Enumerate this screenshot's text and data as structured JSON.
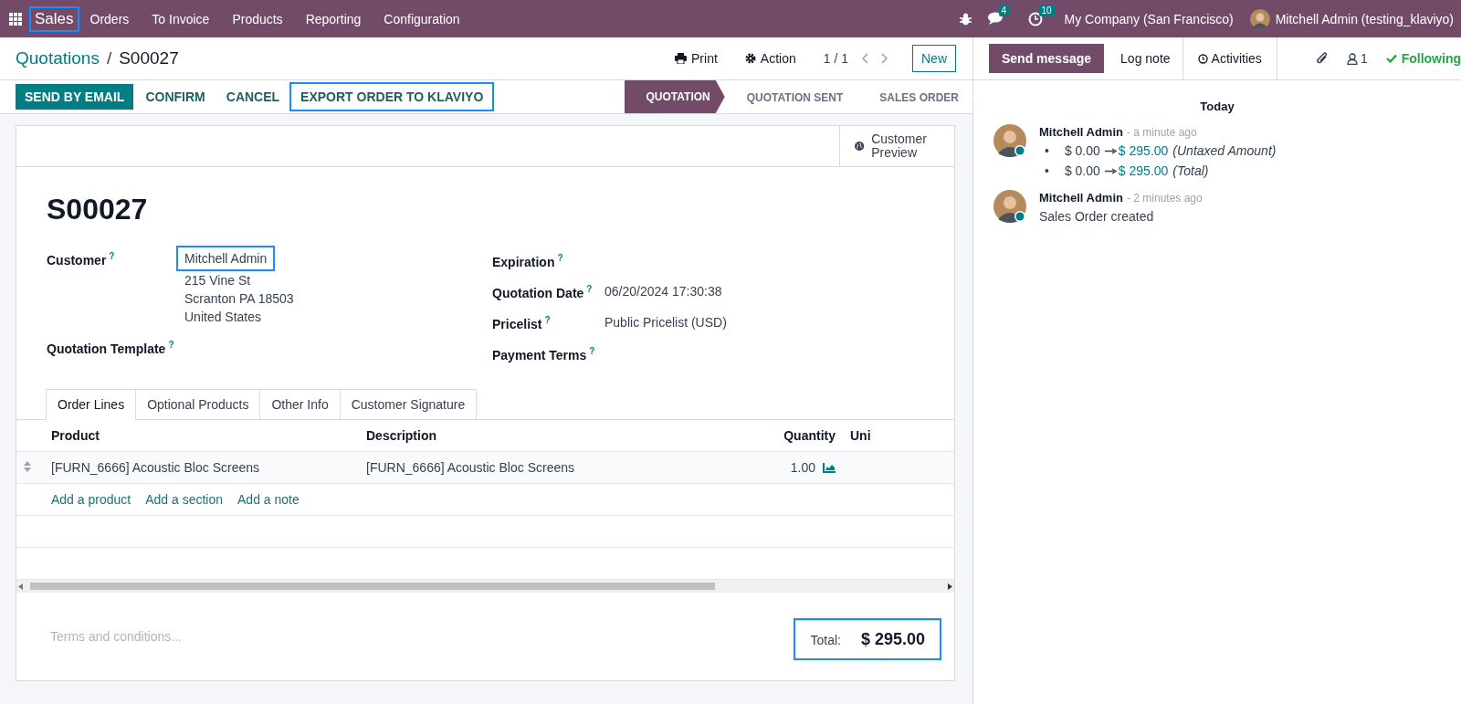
{
  "navbar": {
    "app": {
      "label": "Sales",
      "highlighted": true
    },
    "menu": [
      "Orders",
      "To Invoice",
      "Products",
      "Reporting",
      "Configuration"
    ],
    "messages_count": "4",
    "activities_count": "10",
    "company": "My Company (San Francisco)",
    "user": "Mitchell Admin (testing_klaviyo)"
  },
  "breadcrumb": {
    "parent": "Quotations",
    "separator": "/",
    "current": "S00027"
  },
  "control_panel": {
    "print": "Print",
    "action": "Action",
    "pager": "1 / 1",
    "new": "New"
  },
  "actions": [
    {
      "label": "SEND BY EMAIL",
      "kind": "primary",
      "highlighted": false
    },
    {
      "label": "CONFIRM",
      "kind": "secondary",
      "highlighted": false
    },
    {
      "label": "CANCEL",
      "kind": "secondary",
      "highlighted": false
    },
    {
      "label": "EXPORT ORDER TO KLAVIYO",
      "kind": "secondary",
      "highlighted": true
    }
  ],
  "status_steps": [
    {
      "label": "QUOTATION",
      "selected": true
    },
    {
      "label": "QUOTATION SENT",
      "selected": false
    },
    {
      "label": "SALES ORDER",
      "selected": false
    }
  ],
  "form": {
    "customer_preview": "Customer Preview",
    "name": "S00027",
    "left_fields": [
      {
        "label": "Customer",
        "help": "?",
        "kind": "partner",
        "value": "Mitchell Admin",
        "address": [
          "215 Vine St",
          "Scranton PA 18503",
          "United States"
        ],
        "highlighted": true
      },
      {
        "label": "Quotation Template",
        "help": "?",
        "kind": "text"
      }
    ],
    "right_fields": [
      {
        "label": "Expiration",
        "help": "?"
      },
      {
        "label": "Quotation Date",
        "help": "?",
        "value": "06/20/2024 17:30:38"
      },
      {
        "label": "Pricelist",
        "help": "?",
        "value": "Public Pricelist (USD)"
      },
      {
        "label": "Payment Terms",
        "help": "?"
      }
    ],
    "tabs": [
      {
        "label": "Order Lines",
        "selected": true
      },
      {
        "label": "Optional Products",
        "selected": false
      },
      {
        "label": "Other Info",
        "selected": false
      },
      {
        "label": "Customer Signature",
        "selected": false
      }
    ],
    "table": {
      "columns": [
        "Product",
        "Description",
        "Quantity",
        "Uni"
      ],
      "rows": [
        {
          "product": "[FURN_6666] Acoustic Bloc Screens",
          "description": "[FURN_6666] Acoustic Bloc Screens",
          "quantity": "1.00"
        }
      ],
      "add_links": [
        "Add a product",
        "Add a section",
        "Add a note"
      ]
    },
    "terms_placeholder": "Terms and conditions...",
    "total": {
      "label": "Total:",
      "value": "$ 295.00",
      "highlighted": true
    }
  },
  "chatter": {
    "buttons": [
      {
        "label": "Send message",
        "selected": true
      },
      {
        "label": "Log note",
        "selected": false
      },
      {
        "label": "Activities",
        "selected": false
      }
    ],
    "followers_count": "1",
    "following": "Following",
    "day": "Today",
    "messages": [
      {
        "author": "Mitchell Admin",
        "time": "- a minute ago",
        "kind": "tracking",
        "changes": [
          {
            "bullet": "•",
            "old": "$ 0.00",
            "new": "$ 295.00",
            "field": "(Untaxed Amount)"
          },
          {
            "bullet": "•",
            "old": "$ 0.00",
            "new": "$ 295.00",
            "field": "(Total)"
          }
        ]
      },
      {
        "author": "Mitchell Admin",
        "time": "- 2 minutes ago",
        "kind": "text",
        "body": "Sales Order created"
      }
    ]
  }
}
